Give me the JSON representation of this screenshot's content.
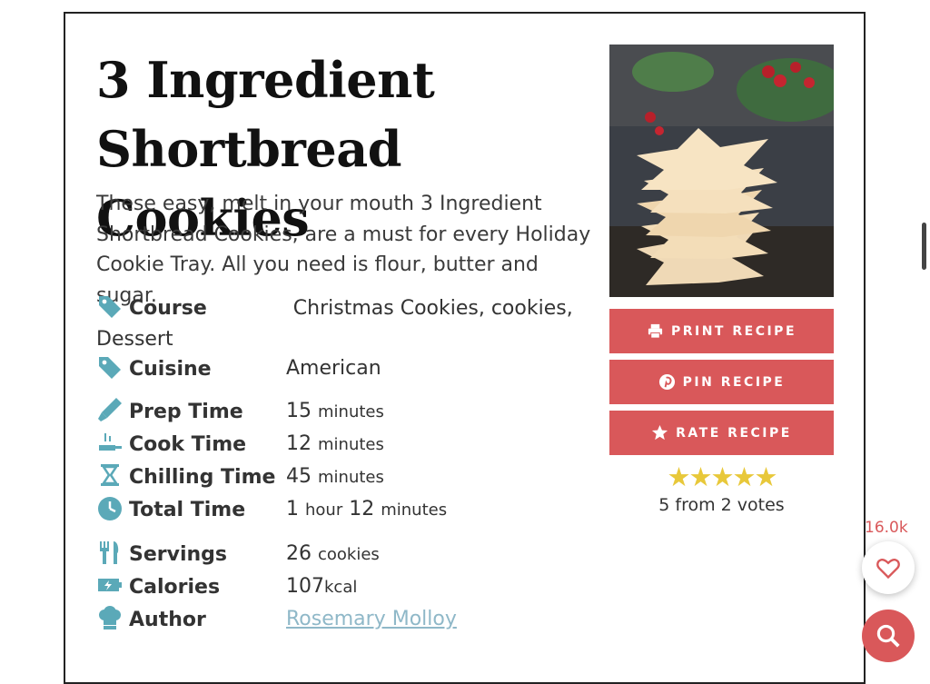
{
  "recipe": {
    "title": "3 Ingredient Shortbread Cookies",
    "summary": "These easy, melt in your mouth 3 Ingredient Shortbread Cookies, are a must for every Holiday Cookie Tray. All you need is flour, butter and sugar."
  },
  "meta": {
    "course": {
      "label": "Course",
      "value": "Christmas Cookies, cookies, Dessert",
      "icon": "tag-icon"
    },
    "cuisine": {
      "label": "Cuisine",
      "value": "American",
      "icon": "tag-icon"
    },
    "prep": {
      "label": "Prep Time",
      "num": "15",
      "unit": "minutes",
      "icon": "knife-icon"
    },
    "cook": {
      "label": "Cook Time",
      "num": "12",
      "unit": "minutes",
      "icon": "pan-icon"
    },
    "chill": {
      "label": "Chilling Time",
      "num": "45",
      "unit": "minutes",
      "icon": "hourglass-icon"
    },
    "total": {
      "label": "Total Time",
      "num1": "1",
      "unit1": "hour",
      "num2": "12",
      "unit2": "minutes",
      "icon": "clock-icon"
    },
    "servings": {
      "label": "Servings",
      "num": "26",
      "unit": "cookies",
      "icon": "utensils-icon"
    },
    "calories": {
      "label": "Calories",
      "num": "107",
      "unit": "kcal",
      "icon": "battery-icon"
    },
    "author": {
      "label": "Author",
      "value": "Rosemary Molloy",
      "icon": "chef-hat-icon"
    }
  },
  "buttons": {
    "print": "PRINT RECIPE",
    "pin": "PIN RECIPE",
    "rate": "RATE RECIPE"
  },
  "rating": {
    "stars": "★★★★★",
    "value": 5,
    "summary": "5 from 2 votes"
  },
  "social": {
    "fav_count": "16.0k"
  },
  "colors": {
    "accent": "#d9585a",
    "icon": "#5ba9b8",
    "star": "#e8c83a",
    "link": "#8fb8c8"
  }
}
